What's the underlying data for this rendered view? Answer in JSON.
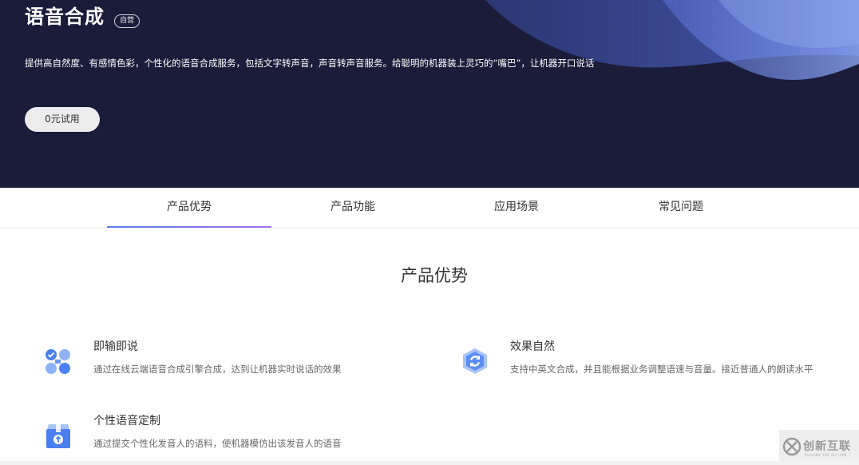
{
  "colors": {
    "hero_bg": "#1b1c3a",
    "tab_indicator_start": "#5b7cf0",
    "tab_indicator_end": "#a46ff0",
    "icon_blue": "#4a7ff0"
  },
  "hero": {
    "title": "语音合成",
    "badge": "自营",
    "description": "提供高自然度、有感情色彩，个性化的语音合成服务，包括文字转声音，声音转声音服务。给聪明的机器装上灵巧的“嘴巴”，让机器开口说话",
    "trial_button": "0元试用"
  },
  "tabs": [
    {
      "label": "产品优势",
      "active": true
    },
    {
      "label": "产品功能",
      "active": false
    },
    {
      "label": "应用场景",
      "active": false
    },
    {
      "label": "常见问题",
      "active": false
    }
  ],
  "section": {
    "title": "产品优势",
    "features": [
      {
        "name": "即输即说",
        "description": "通过在线云端语音合成引擎合成，达到让机器实时说话的效果",
        "icon": "nodes-icon"
      },
      {
        "name": "效果自然",
        "description": "支持中英文合成，并且能根据业务调整语速与音量。接近普通人的朗读水平",
        "icon": "sync-icon"
      },
      {
        "name": "个性语音定制",
        "description": "通过提交个性化发音人的语料，使机器模仿出该发音人的语音",
        "icon": "box-upload-icon"
      }
    ]
  },
  "watermark": {
    "text": "创新互联",
    "subtext": "CHUANG XIN HU LIAN",
    "icon": "logo-icon"
  }
}
